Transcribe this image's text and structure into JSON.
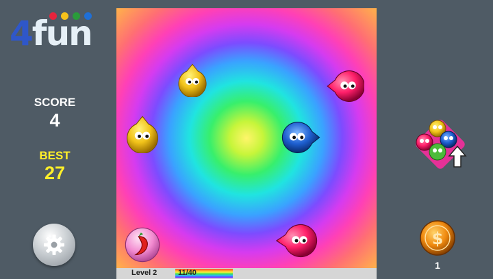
{
  "logo": {
    "four": "4",
    "letters": [
      "f",
      "u",
      "n"
    ],
    "dot_colors": [
      "#e8243c",
      "#f7c21b",
      "#2a9b3a",
      "#1f6fd6"
    ]
  },
  "score": {
    "label": "SCORE",
    "value": "4"
  },
  "best": {
    "label": "BEST",
    "value": "27"
  },
  "status": {
    "level": "Level 2",
    "progress_text": "11/40",
    "progress": 0.275
  },
  "coins": {
    "count": "1",
    "icon": "dollar-coin-icon"
  },
  "settings": {
    "icon": "gear-icon"
  },
  "colors": {
    "yellow": "#f2c31a",
    "pink": "#ff1f6a",
    "blue": "#1e5fd0",
    "green": "#4dbb3a",
    "background": "#4f5b65",
    "best": "#ffef2a"
  }
}
